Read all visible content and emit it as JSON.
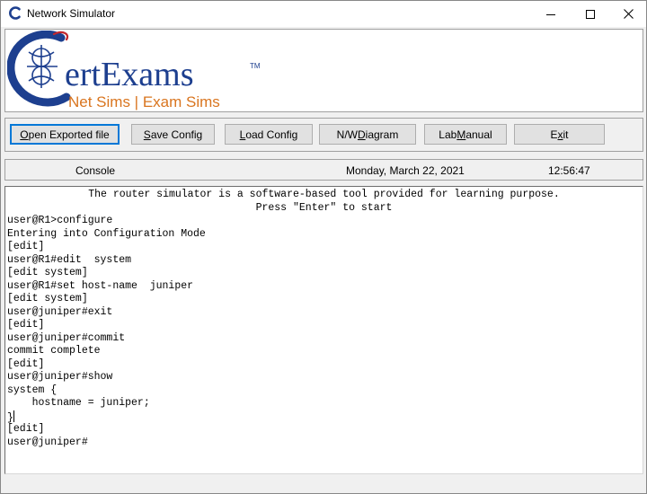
{
  "window": {
    "title": "Network Simulator",
    "minimize_icon": "minimize-icon",
    "maximize_icon": "maximize-icon",
    "close_icon": "close-icon"
  },
  "logo": {
    "brand": "ertExams",
    "brand_initial": "C",
    "trademark": "TM",
    "tagline": "Net Sims | Exam Sims",
    "colors": {
      "blue": "#1d3f8f",
      "orange": "#d9751f"
    }
  },
  "toolbar": {
    "buttons": [
      {
        "label_pre": "",
        "label_acc": "O",
        "label_post": "pen Exported file"
      },
      {
        "label_pre": "",
        "label_acc": "S",
        "label_post": "ave Config"
      },
      {
        "label_pre": "",
        "label_acc": "L",
        "label_post": "oad Config"
      },
      {
        "label_pre": "N/W ",
        "label_acc": "D",
        "label_post": "iagram"
      },
      {
        "label_pre": "Lab ",
        "label_acc": "M",
        "label_post": "anual"
      },
      {
        "label_pre": "E",
        "label_acc": "x",
        "label_post": "it"
      }
    ]
  },
  "status": {
    "label": "Console",
    "date": "Monday, March 22, 2021",
    "time": "12:56:47"
  },
  "console": {
    "banner_1": "The router simulator is a software-based tool provided for learning purpose.",
    "banner_2": "Press \"Enter\" to start",
    "lines": [
      "user@R1>configure",
      "Entering into Configuration Mode",
      "[edit]",
      "user@R1#edit  system",
      "[edit system]",
      "user@R1#set host-name  juniper",
      "[edit system]",
      "user@juniper#exit",
      "[edit]",
      "user@juniper#commit",
      "commit complete",
      "[edit]",
      "user@juniper#show",
      "system {",
      "    hostname = juniper;",
      "}",
      "[edit]",
      "user@juniper#"
    ]
  }
}
